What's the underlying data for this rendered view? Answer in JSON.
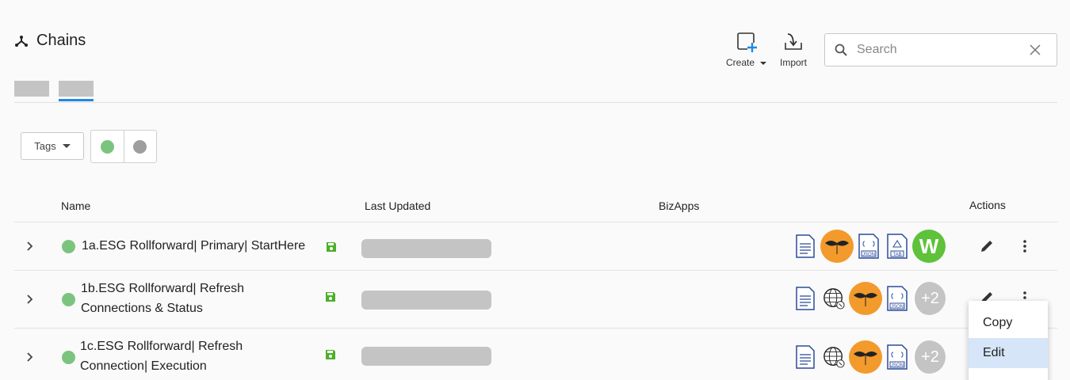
{
  "header": {
    "title": "Chains",
    "icon": "chains-icon"
  },
  "toolbar": {
    "create_label": "Create",
    "import_label": "Import"
  },
  "search": {
    "placeholder": "Search"
  },
  "filters": {
    "tags_label": "Tags",
    "status_colors": {
      "active": "#7bc47f",
      "inactive": "#9e9e9e"
    }
  },
  "table": {
    "headers": {
      "name": "Name",
      "last_updated": "Last Updated",
      "bizapps": "BizApps",
      "actions": "Actions"
    },
    "rows": [
      {
        "name_line1": "1a.ESG Rollforward| Primary| StartHere",
        "name_line2": "",
        "status": "active",
        "apps": [
          "document-icon",
          "mustache-app-icon",
          "json-file-icon",
          "tab-file-icon",
          "workiva-icon"
        ],
        "more_count": ""
      },
      {
        "name_line1": "1b.ESG Rollforward| Refresh",
        "name_line2": "Connections & Status",
        "status": "active",
        "apps": [
          "document-icon",
          "globe-icon",
          "mustache-app-icon",
          "json-file-icon"
        ],
        "more_count": "+2"
      },
      {
        "name_line1": "1c.ESG Rollforward| Refresh",
        "name_line2": "Connection| Execution",
        "status": "active",
        "apps": [
          "document-icon",
          "globe-icon",
          "mustache-app-icon",
          "json-file-icon"
        ],
        "more_count": "+2"
      }
    ]
  },
  "context_menu": {
    "items": [
      "Copy",
      "Edit"
    ],
    "highlighted": "Edit"
  },
  "colors": {
    "accent": "#1e88e5",
    "active_green": "#7bc47f",
    "save_green": "#4caf2a",
    "orange": "#f39a2c"
  }
}
